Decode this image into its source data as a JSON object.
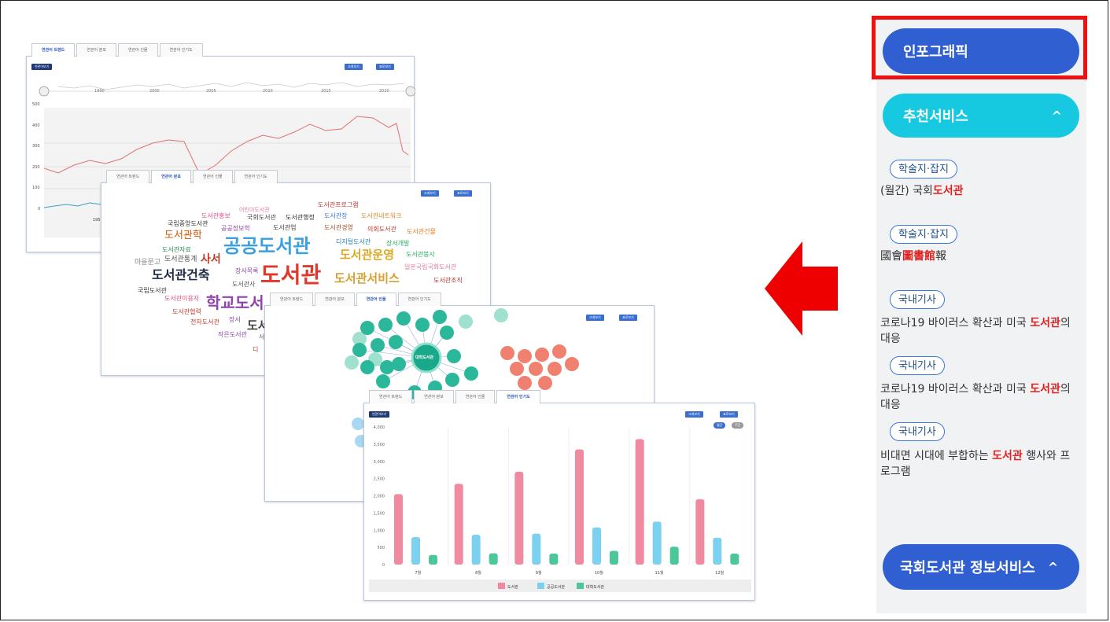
{
  "panels": {
    "trend": {
      "tabs": [
        "연관어 트렌드",
        "연관어 분포",
        "연관어 인물",
        "연관어 인기도"
      ],
      "top_label": "연관어보기",
      "btn_1": "크게보기",
      "btn_2": "표로보기",
      "years": [
        "1990",
        "2000",
        "2005",
        "2010",
        "2015",
        "2020"
      ],
      "yticks": [
        "500",
        "400",
        "300",
        "200",
        "100",
        "0"
      ],
      "xstart": "195"
    },
    "cloud": {
      "tabs": [
        "연관어 트렌드",
        "연관어 분포",
        "연관어 인물",
        "연관어 인기도"
      ],
      "btn_1": "크게보기",
      "btn_2": "표로보기",
      "words": [
        {
          "t": "도서관프로그램",
          "c": "#c0392b"
        },
        {
          "t": "어린이도서관",
          "c": "#e07b9a"
        },
        {
          "t": "도서관홍보",
          "c": "#e64a88"
        },
        {
          "t": "국회도서관",
          "c": "#444"
        },
        {
          "t": "도서관행정",
          "c": "#333"
        },
        {
          "t": "도서관장",
          "c": "#3b78d6"
        },
        {
          "t": "도서관네트워크",
          "c": "#d88b2f"
        },
        {
          "t": "국립중앙도서관",
          "c": "#333"
        },
        {
          "t": "공공정보학",
          "c": "#8e44ad"
        },
        {
          "t": "도서관업",
          "c": "#444"
        },
        {
          "t": "도서관경영",
          "c": "#a0522d"
        },
        {
          "t": "의회도서관",
          "c": "#c0392b"
        },
        {
          "t": "도서관건물",
          "c": "#e67e22"
        },
        {
          "t": "도서관학",
          "c": "#d35400"
        },
        {
          "t": "공공도서관",
          "c": "#3aa0e0"
        },
        {
          "t": "디지털도서관",
          "c": "#2980b9"
        },
        {
          "t": "장서개발",
          "c": "#27ae60"
        },
        {
          "t": "도서관자료",
          "c": "#2c8c5a"
        },
        {
          "t": "도서관운영",
          "c": "#e0a820"
        },
        {
          "t": "도서관봉사",
          "c": "#27ae60"
        },
        {
          "t": "마을문고",
          "c": "#888"
        },
        {
          "t": "도서관통계",
          "c": "#555"
        },
        {
          "t": "사서",
          "c": "#c0392b"
        },
        {
          "t": "일본국립국회도서관",
          "c": "#e07b9a"
        },
        {
          "t": "도서관건축",
          "c": "#1f2a44"
        },
        {
          "t": "장서목록",
          "c": "#8e44ad"
        },
        {
          "t": "도서관",
          "c": "#e0392b"
        },
        {
          "t": "도서관서비스",
          "c": "#d8a030"
        },
        {
          "t": "도서관조직",
          "c": "#c0392b"
        },
        {
          "t": "도서관사",
          "c": "#555"
        },
        {
          "t": "국립도서관",
          "c": "#333"
        },
        {
          "t": "도서관이용자",
          "c": "#e64a88"
        },
        {
          "t": "학교도서",
          "c": "#8e44ad"
        },
        {
          "t": "도서관협력",
          "c": "#c0392b"
        },
        {
          "t": "전자도서관",
          "c": "#c0392b"
        },
        {
          "t": "장서",
          "c": "#8e44ad"
        },
        {
          "t": "도서",
          "c": "#444"
        },
        {
          "t": "작은도서관",
          "c": "#8e44ad"
        },
        {
          "t": "디",
          "c": "#c0392b"
        },
        {
          "t": "서",
          "c": "#666"
        }
      ]
    },
    "network": {
      "tabs": [
        "연관어 트렌드",
        "연관어 분포",
        "연관어 인물",
        "연관어 인기도"
      ],
      "btn_1": "크게보기",
      "btn_2": "표로보기",
      "center": "대학도서관"
    },
    "bar": {
      "tabs": [
        "연관어 트렌드",
        "연관어 분포",
        "연관어 인물",
        "연관어 인기도"
      ],
      "top_label": "연관어보기",
      "btn_1": "크게보기",
      "btn_2": "표로보기",
      "toggle_1": "월간",
      "toggle_2": "주간"
    }
  },
  "chart_data": {
    "type": "bar",
    "categories": [
      "7월",
      "8월",
      "9월",
      "10월",
      "11월",
      "12월"
    ],
    "series": [
      {
        "name": "도서관",
        "values": [
          2050,
          2350,
          2700,
          3350,
          3650,
          1900
        ],
        "color": "#f08aa0"
      },
      {
        "name": "공공도서관",
        "values": [
          800,
          870,
          900,
          1080,
          1250,
          780
        ],
        "color": "#7cd0f0"
      },
      {
        "name": "대학도서관",
        "values": [
          280,
          330,
          320,
          400,
          520,
          320
        ],
        "color": "#4cc79a"
      }
    ],
    "ylim": [
      0,
      4000
    ],
    "yticks": [
      "4,000",
      "3,500",
      "3,000",
      "2,500",
      "2,000",
      "1,500",
      "1,000",
      "500",
      "0"
    ]
  },
  "sidebar": {
    "infographic": "인포그래픽",
    "recommend": "추천서비스",
    "recommend_chevron": "^",
    "national": "국회도서관 정보서비스",
    "national_chevron": "^",
    "items": [
      {
        "tag": "학술지·잡지",
        "pre": "(월간) 국회",
        "hl": "도서관",
        "post": ""
      },
      {
        "tag": "학술지·잡지",
        "pre": "國會",
        "hl": "圖書館",
        "post": "報"
      },
      {
        "tag": "국내기사",
        "pre": "코로나19 바이러스 확산과 미국 ",
        "hl": "도서관",
        "post": "의 대응"
      },
      {
        "tag": "국내기사",
        "pre": "코로나19 바이러스 확산과 미국 ",
        "hl": "도서관",
        "post": "의 대응"
      },
      {
        "tag": "국내기사",
        "pre": "비대면 시대에 부합하는 ",
        "hl": "도서관",
        "post": " 행사와 프로그램"
      }
    ]
  },
  "colors": {
    "arrow": "#ee0000",
    "pill_blue": "#2f5fd0",
    "pill_cyan": "#16c8e0",
    "highlight_box": "#ee1111"
  }
}
